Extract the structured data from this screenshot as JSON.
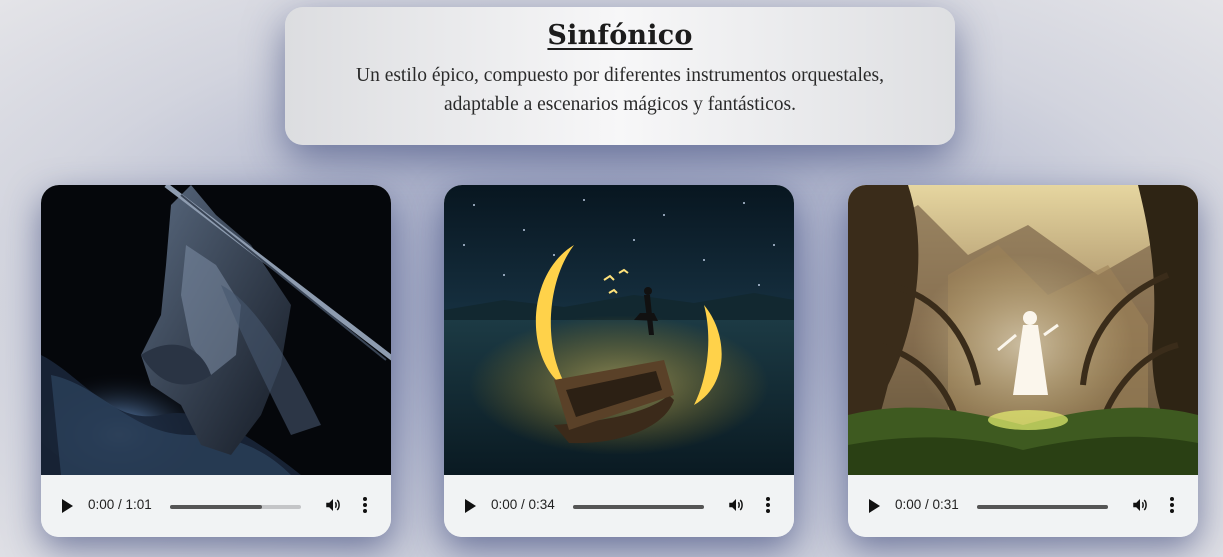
{
  "header": {
    "title": "Sinfónico",
    "description": "Un estilo épico, compuesto por diferentes instrumentos orquestales, adaptable a escenarios mágicos y fantásticos."
  },
  "cards": [
    {
      "image": "dark-knight-artwork",
      "time": "0:00 / 1:01",
      "progress": 0.7
    },
    {
      "image": "moon-boat-artwork",
      "time": "0:00 / 0:34",
      "progress": 1.0
    },
    {
      "image": "forest-spirit-artwork",
      "time": "0:00 / 0:31",
      "progress": 1.0
    }
  ],
  "colors": {
    "accent_shadow": "#283470",
    "player_bg": "#f1f3f4",
    "progress_fill": "#555555",
    "progress_track": "#c4c5c7"
  },
  "icons": {
    "play": "play-icon",
    "volume": "volume-icon",
    "more": "more-vertical-icon"
  }
}
